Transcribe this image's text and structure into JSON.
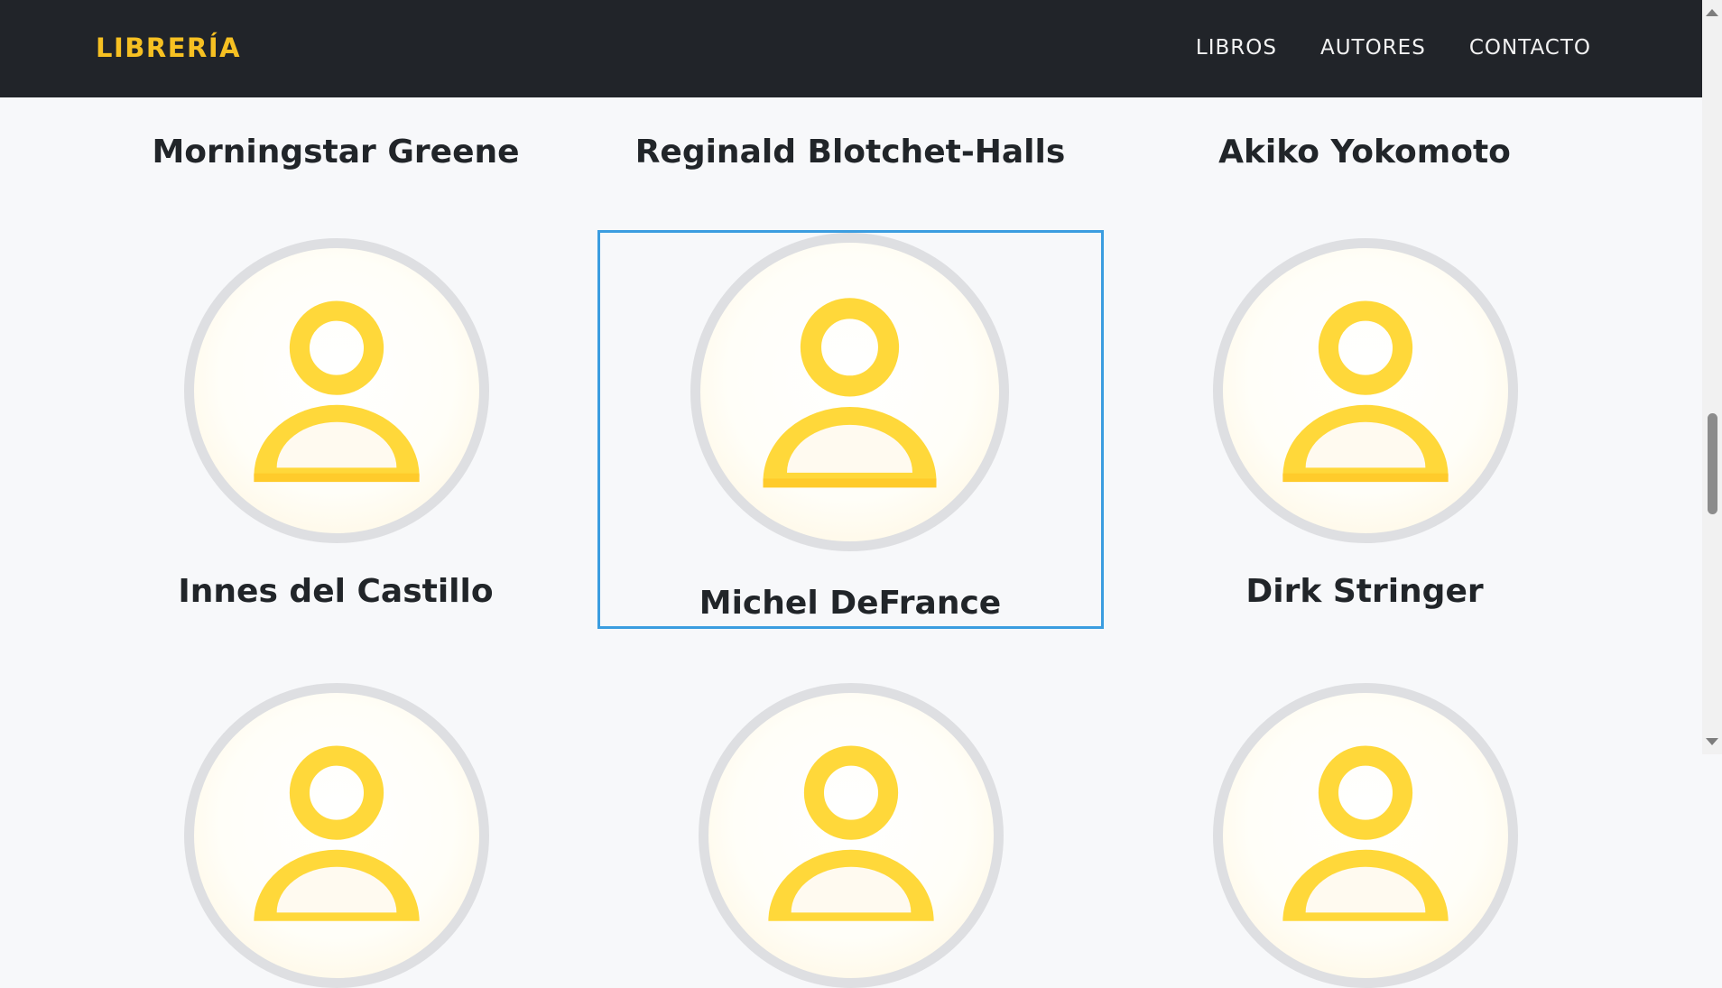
{
  "brand": "LIBRERÍA",
  "nav": [
    "LIBROS",
    "AUTORES",
    "CONTACTO"
  ],
  "authors": {
    "row1": [
      "Morningstar Greene",
      "Reginald Blotchet-Halls",
      "Akiko Yokomoto"
    ],
    "row2": [
      "Innes del Castillo",
      "Michel DeFrance",
      "Dirk Stringer"
    ]
  },
  "colors": {
    "navbar": "#212429",
    "brand": "#f6c022",
    "avatar_icon": "#ffd83a",
    "selection_outline": "#3b9de0"
  },
  "icons": {
    "avatar": "user-placeholder-icon"
  }
}
